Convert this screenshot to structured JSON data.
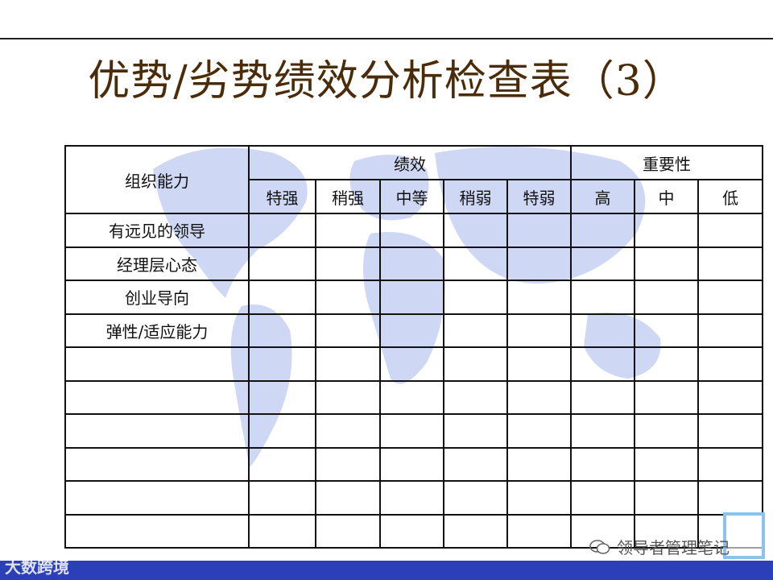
{
  "title": "优势/劣势绩效分析检查表（3）",
  "table": {
    "corner_label": "组织能力",
    "group_headers": {
      "performance": "绩效",
      "importance": "重要性"
    },
    "performance_cols": [
      "特强",
      "稍强",
      "中等",
      "稍弱",
      "特弱"
    ],
    "importance_cols": [
      "高",
      "中",
      "低"
    ],
    "rows": [
      "有远见的领导",
      "经理层心态",
      "创业导向",
      "弹性/适应能力",
      "",
      "",
      "",
      "",
      "",
      ""
    ]
  },
  "watermark": {
    "left_brand": "大数跨境",
    "wechat_account": "领导者管理笔记"
  },
  "colors": {
    "title": "#4a2c0a",
    "bottom_bar": "#2a3fb8",
    "map": "#c9d3f2"
  }
}
